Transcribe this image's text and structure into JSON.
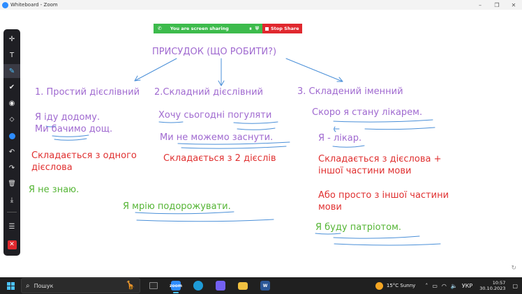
{
  "window": {
    "title": "Whiteboard - Zoom"
  },
  "share_bar": {
    "status": "You are screen sharing",
    "stop_label": "Stop Share"
  },
  "toolbar": {
    "items": [
      {
        "name": "move-icon",
        "glyph": "✛"
      },
      {
        "name": "text-icon",
        "glyph": "T"
      },
      {
        "name": "pen-icon",
        "glyph": "✎"
      },
      {
        "name": "check-icon",
        "glyph": "✔"
      },
      {
        "name": "spotlight-icon",
        "glyph": "◉"
      },
      {
        "name": "eraser-icon",
        "glyph": "⬦"
      },
      {
        "name": "color-icon",
        "glyph": ""
      },
      {
        "name": "undo-icon",
        "glyph": "↶"
      },
      {
        "name": "redo-icon",
        "glyph": "↷"
      },
      {
        "name": "trash-icon",
        "glyph": "🗑"
      },
      {
        "name": "download-icon",
        "glyph": "⤓"
      },
      {
        "name": "menu-icon",
        "glyph": "☰"
      },
      {
        "name": "close-icon",
        "glyph": "✕"
      }
    ]
  },
  "board": {
    "heading": "ПРИСУДОК  (ЩО РОБИТИ?)",
    "col1": {
      "title": "1. Простий дієслівний",
      "ex1": "Я іду додому.",
      "ex2": "Ми бачимо дощ.",
      "rule_line1": "Складається з одного",
      "rule_line2": "дієслова",
      "green_example": "Я не знаю."
    },
    "col2": {
      "title": "2.Складний дієслівний",
      "ex1": "Хочу сьогодні погуляти",
      "ex2": "Ми не можемо заснути.",
      "rule": "Складається з 2 дієслів",
      "green_example": "Я мрію подорожувати."
    },
    "col3": {
      "title": "3. Складений іменний",
      "ex1": "Скоро я стану лікарем.",
      "ex2": "Я - лікар.",
      "rule_line1": "Складається з дієслова +",
      "rule_line2": "іншої частини мови",
      "alt_line1": "Або просто з іншої частини",
      "alt_line2": "мови",
      "green_example": "Я буду патріотом."
    }
  },
  "taskbar": {
    "search_placeholder": "Пошук",
    "apps": [
      {
        "name": "task-view-icon",
        "label": "",
        "color": "#2b2b2b"
      },
      {
        "name": "zoom-app-icon",
        "label": "zoom",
        "color": "#2d8cff"
      },
      {
        "name": "edge-app-icon",
        "label": "",
        "color": "#1e9bd7"
      },
      {
        "name": "viber-app-icon",
        "label": "",
        "color": "#7360f2"
      },
      {
        "name": "explorer-app-icon",
        "label": "",
        "color": "#f0c040"
      },
      {
        "name": "word-app-icon",
        "label": "W",
        "color": "#2b5797"
      }
    ],
    "weather": "15°C  Sunny",
    "language": "УКР",
    "time": "10:57",
    "date": "30.10.2023"
  },
  "colors": {
    "heading": "#a06ad0",
    "rule_red": "#e03030",
    "example_green": "#55b535",
    "strokes_blue": "#4a8fd8",
    "share_green": "#3dbb4c",
    "share_red": "#e0282e"
  }
}
